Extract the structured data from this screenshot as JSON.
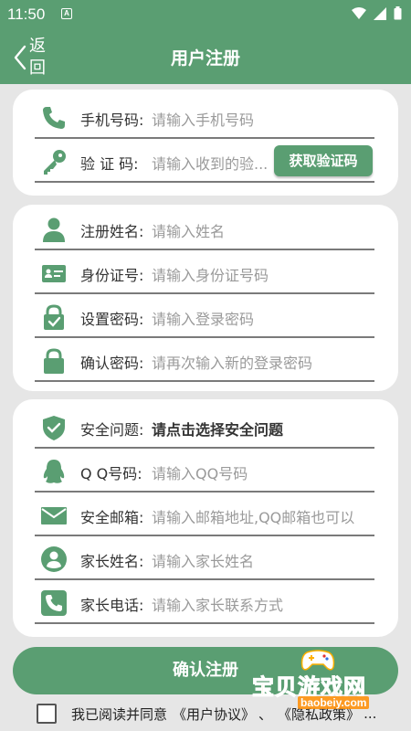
{
  "status_bar": {
    "time": "11:50",
    "badge": "A"
  },
  "app_bar": {
    "back_label": "返回",
    "title": "用户注册"
  },
  "phone_section": {
    "phone": {
      "label": "手机号码:",
      "placeholder": "请输入手机号码",
      "icon": "phone-icon"
    },
    "code": {
      "label": "验 证 码:",
      "placeholder": "请输入收到的验...",
      "icon": "key-icon",
      "button": "获取验证码"
    }
  },
  "account_section": [
    {
      "label": "注册姓名:",
      "placeholder": "请输入姓名",
      "icon": "person-icon"
    },
    {
      "label": "身份证号:",
      "placeholder": "请输入身份证号码",
      "icon": "id-card-icon"
    },
    {
      "label": "设置密码:",
      "placeholder": "请输入登录密码",
      "icon": "lock-check-icon"
    },
    {
      "label": "确认密码:",
      "placeholder": "请再次输入新的登录密码",
      "icon": "lock-icon"
    }
  ],
  "safety_section": [
    {
      "label": "安全问题:",
      "placeholder": "请点击选择安全问题",
      "icon": "shield-check-icon"
    },
    {
      "label": "Q Q号码:",
      "placeholder": "请输入QQ号码",
      "icon": "qq-icon"
    },
    {
      "label": "安全邮箱:",
      "placeholder": "请输入邮箱地址,QQ邮箱也可以",
      "icon": "mail-icon"
    },
    {
      "label": "家长姓名:",
      "placeholder": "请输入家长姓名",
      "icon": "person-circle-icon"
    },
    {
      "label": "家长电话:",
      "placeholder": "请输入家长联系方式",
      "icon": "phone-square-icon"
    }
  ],
  "submit_label": "确认注册",
  "agreement": {
    "prefix": "我已阅读并同意",
    "user_agreement": "《用户协议》",
    "separator": "、",
    "privacy": "《隐私政策》",
    "ellipsis": "..."
  },
  "watermark": {
    "text": "宝贝游戏网",
    "url": "baobeiy.com"
  },
  "colors": {
    "primary": "#5a9e72",
    "background": "#e6e6e6",
    "card": "#ffffff"
  }
}
